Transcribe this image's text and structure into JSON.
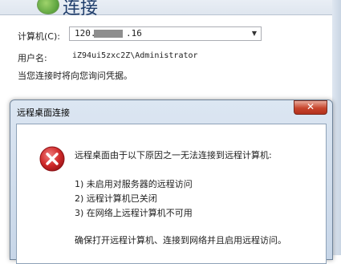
{
  "background_window": {
    "banner_title": "连接",
    "computer_label": "计算机(C):",
    "computer_value_prefix": "120.",
    "computer_value_suffix": ".16",
    "username_label": "用户名:",
    "username_value": "iZ94ui5zxc2Z\\Administrator",
    "hint": "当您连接时将向您询问凭据。"
  },
  "dialog": {
    "title": "远程桌面连接",
    "close_glyph": "✕",
    "icon": "error-icon",
    "message_main": "远程桌面由于以下原因之一无法连接到远程计算机:",
    "reasons": [
      "1) 未启用对服务器的远程访问",
      "2) 远程计算机已关闭",
      "3) 在网络上远程计算机不可用"
    ],
    "footer": "确保打开远程计算机、连接到网络并且启用远程访问。"
  },
  "colors": {
    "error_red": "#c8202a",
    "title_bar": "#dce6f2",
    "close_button": "#c7452d"
  }
}
